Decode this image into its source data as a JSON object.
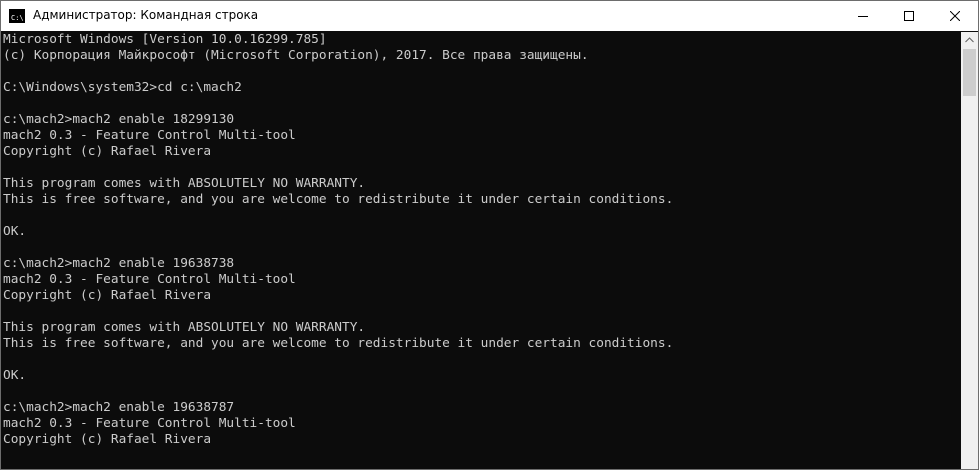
{
  "window": {
    "title": "Администратор: Командная строка",
    "icon": "cmd-icon",
    "controls": {
      "minimize": "minimize-icon",
      "maximize": "maximize-icon",
      "close": "close-icon"
    }
  },
  "console": {
    "lines": [
      "Microsoft Windows [Version 10.0.16299.785]",
      "(c) Корпорация Майкрософт (Microsoft Corporation), 2017. Все права защищены.",
      "",
      "C:\\Windows\\system32>cd c:\\mach2",
      "",
      "c:\\mach2>mach2 enable 18299130",
      "mach2 0.3 - Feature Control Multi-tool",
      "Copyright (c) Rafael Rivera",
      "",
      "This program comes with ABSOLUTELY NO WARRANTY.",
      "This is free software, and you are welcome to redistribute it under certain conditions.",
      "",
      "OK.",
      "",
      "c:\\mach2>mach2 enable 19638738",
      "mach2 0.3 - Feature Control Multi-tool",
      "Copyright (c) Rafael Rivera",
      "",
      "This program comes with ABSOLUTELY NO WARRANTY.",
      "This is free software, and you are welcome to redistribute it under certain conditions.",
      "",
      "OK.",
      "",
      "c:\\mach2>mach2 enable 19638787",
      "mach2 0.3 - Feature Control Multi-tool",
      "Copyright (c) Rafael Rivera"
    ]
  },
  "colors": {
    "console_bg": "#0c0c0c",
    "console_fg": "#cccccc"
  }
}
